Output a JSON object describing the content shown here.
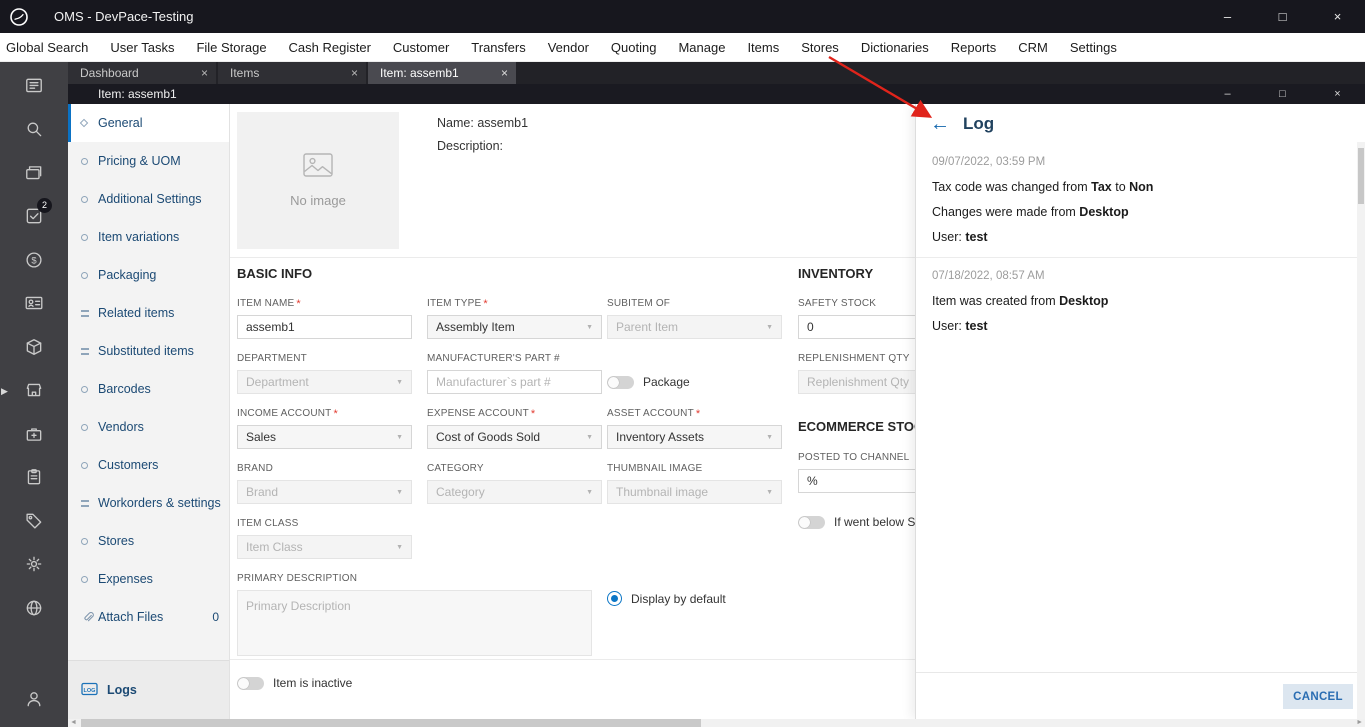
{
  "window": {
    "title": "OMS - DevPace-Testing"
  },
  "menu": {
    "items": [
      "Global Search",
      "User Tasks",
      "File Storage",
      "Cash Register",
      "Customer",
      "Transfers",
      "Vendor",
      "Quoting",
      "Manage",
      "Items",
      "Stores",
      "Dictionaries",
      "Reports",
      "CRM",
      "Settings"
    ]
  },
  "tabs": [
    {
      "label": "Dashboard",
      "active": false
    },
    {
      "label": "Items",
      "active": false
    },
    {
      "label": "Item: assemb1",
      "active": true
    }
  ],
  "sidebar": {
    "icons": [
      {
        "name": "dashboard-icon"
      },
      {
        "name": "search-icon"
      },
      {
        "name": "file-storage-icon"
      },
      {
        "name": "tasks-icon",
        "badge": "2"
      },
      {
        "name": "cash-register-icon"
      },
      {
        "name": "customer-icon"
      },
      {
        "name": "items-icon"
      },
      {
        "name": "stores-icon"
      },
      {
        "name": "medkit-icon"
      },
      {
        "name": "clipboard-icon"
      },
      {
        "name": "tag-icon"
      },
      {
        "name": "settings-icon"
      },
      {
        "name": "globe-icon"
      }
    ],
    "bottom_icon": {
      "name": "user-icon"
    }
  },
  "item_window": {
    "title": "Item: assemb1"
  },
  "nav": {
    "items": [
      {
        "label": "General",
        "icon": "diamond",
        "active": true
      },
      {
        "label": "Pricing & UOM",
        "icon": "circle"
      },
      {
        "label": "Additional Settings",
        "icon": "circle"
      },
      {
        "label": "Item variations",
        "icon": "circle"
      },
      {
        "label": "Packaging",
        "icon": "circle"
      },
      {
        "label": "Related items",
        "icon": "equals"
      },
      {
        "label": "Substituted items",
        "icon": "equals"
      },
      {
        "label": "Barcodes",
        "icon": "circle"
      },
      {
        "label": "Vendors",
        "icon": "circle"
      },
      {
        "label": "Customers",
        "icon": "circle"
      },
      {
        "label": "Workorders & settings",
        "icon": "equals"
      },
      {
        "label": "Stores",
        "icon": "circle"
      },
      {
        "label": "Expenses",
        "icon": "circle"
      },
      {
        "label": "Attach Files",
        "icon": "paperclip",
        "badge": "0"
      }
    ],
    "logs_label": "Logs"
  },
  "general_tab": {
    "no_image_label": "No image",
    "name_label": "Name:",
    "name_value": "assemb1",
    "description_label": "Description:"
  },
  "form": {
    "section_title": "BASIC INFO",
    "fields": [
      {
        "label": "ITEM NAME",
        "required": true,
        "type": "input",
        "value": "assemb1",
        "col": 1,
        "row": 1
      },
      {
        "label": "ITEM TYPE",
        "required": true,
        "type": "select",
        "value": "Assembly Item",
        "col": 2,
        "row": 1
      },
      {
        "label": "SUBITEM OF",
        "type": "select",
        "placeholder": "Parent Item",
        "disabled": true,
        "col": 3,
        "row": 1
      },
      {
        "label": "DEPARTMENT",
        "type": "select",
        "placeholder": "Department",
        "disabled": true,
        "col": 1,
        "row": 2
      },
      {
        "label": "MANUFACTURER'S PART #",
        "type": "input",
        "placeholder": "Manufacturer`s part #",
        "col": 2,
        "row": 2
      },
      {
        "label": "INCOME ACCOUNT",
        "required": true,
        "type": "select",
        "value": "Sales",
        "col": 1,
        "row": 3
      },
      {
        "label": "EXPENSE ACCOUNT",
        "required": true,
        "type": "select",
        "value": "Cost of Goods Sold",
        "col": 2,
        "row": 3
      },
      {
        "label": "ASSET ACCOUNT",
        "required": true,
        "type": "select",
        "value": "Inventory Assets",
        "col": 3,
        "row": 3
      },
      {
        "label": "BRAND",
        "type": "select",
        "placeholder": "Brand",
        "disabled": true,
        "col": 1,
        "row": 4
      },
      {
        "label": "CATEGORY",
        "type": "select",
        "placeholder": "Category",
        "disabled": true,
        "col": 2,
        "row": 4
      },
      {
        "label": "THUMBNAIL IMAGE",
        "type": "select",
        "placeholder": "Thumbnail image",
        "disabled": true,
        "col": 3,
        "row": 4
      },
      {
        "label": "ITEM CLASS",
        "type": "select",
        "placeholder": "Item Class",
        "disabled": true,
        "col": 1,
        "row": 5
      }
    ],
    "package_toggle_label": "Package",
    "primary_description_label": "PRIMARY DESCRIPTION",
    "primary_description_placeholder": "Primary Description",
    "display_by_default_label": "Display by default",
    "item_inactive_label": "Item is inactive"
  },
  "inventory": {
    "section_title": "INVENTORY",
    "safety_stock_label": "SAFETY STOCK",
    "safety_stock_value": "0",
    "replenishment_label": "REPLENISHMENT QTY",
    "replenishment_placeholder": "Replenishment Qty",
    "ecommerce_title": "ECOMMERCE STOCK",
    "posted_label": "POSTED TO CHANNEL",
    "posted_value": "%",
    "below_safety_label": "If went below Sa"
  },
  "log_panel": {
    "title": "Log",
    "entries": [
      {
        "timestamp": "09/07/2022, 03:59 PM",
        "lines": [
          [
            [
              "Tax code was changed from ",
              false
            ],
            [
              "Tax",
              true
            ],
            [
              " to ",
              false
            ],
            [
              "Non",
              true
            ]
          ],
          [
            [
              "Changes were made from ",
              false
            ],
            [
              "Desktop",
              true
            ]
          ],
          [
            [
              "User: ",
              false
            ],
            [
              "test",
              true
            ]
          ]
        ]
      },
      {
        "timestamp": "07/18/2022, 08:57 AM",
        "lines": [
          [
            [
              "Item was created from ",
              false
            ],
            [
              "Desktop",
              true
            ]
          ],
          [
            [
              "User: ",
              false
            ],
            [
              "test",
              true
            ]
          ]
        ]
      }
    ],
    "cancel_label": "CANCEL"
  },
  "icons": {
    "minimize": "–",
    "maximize": "□",
    "close": "×",
    "back": "←",
    "caret_down": "▼",
    "tab_close": "×",
    "expander": "▶",
    "scroll_left": "◄",
    "scroll_right": "►"
  },
  "colors": {
    "accent_blue": "#0b72c4",
    "nav_text": "#1c4a74",
    "required_red": "#e23b30",
    "annotation_red": "#e0241b",
    "cancel_bg": "#dce6f0",
    "cancel_text": "#2a6db2"
  }
}
